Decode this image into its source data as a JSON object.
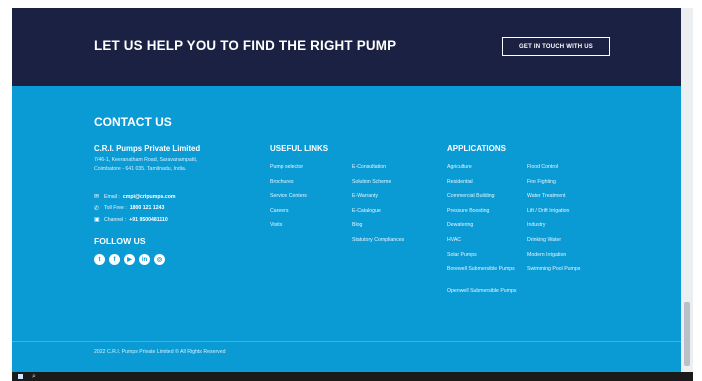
{
  "banner": {
    "title": "LET US HELP YOU TO FIND THE RIGHT PUMP",
    "cta_label": "GET IN TOUCH WITH US"
  },
  "contact": {
    "section_title": "CONTACT US",
    "company": "C.R.I. Pumps Private Limited",
    "address_line1": "7/46-1, Keeranatham Road, Saravanampatti,",
    "address_line2": "Coimbatore - 641 035. Tamilnadu, India.",
    "email_label": "Email :",
    "email_value": "cmpi@cripumps.com",
    "tollfree_label": "Toll Free :",
    "tollfree_value": "1800 121 1243",
    "channel_label": "Channel :",
    "channel_value": "+91 9500481110",
    "follow_title": "FOLLOW US",
    "social_icons": [
      "twitter-icon",
      "facebook-icon",
      "youtube-icon",
      "linkedin-icon",
      "instagram-icon"
    ]
  },
  "useful_links": {
    "title": "USEFUL LINKS",
    "col1": [
      "Pump selector",
      "Brochures",
      "Service Centers",
      "Careers",
      "Visits"
    ],
    "col2": [
      "E-Consultation",
      "Solution Scheme",
      "E-Warranty",
      "E-Catalogue",
      "Blog",
      "Statutory Compliances"
    ]
  },
  "applications": {
    "title": "APPLICATIONS",
    "col1": [
      "Agriculture",
      "Residential",
      "Commercial Building",
      "Pressure Boosting",
      "Dewatering",
      "HVAC",
      "Solar Pumps",
      "Borewell Submersible Pumps",
      "Openwell Submersible Pumps"
    ],
    "col2": [
      "Flood Control",
      "Fire Fighting",
      "Water Treatment",
      "Lift / Drift Irrigation",
      "Industry",
      "Drinking Water",
      "Modern Irrigation",
      "Swimming Pool Pumps"
    ]
  },
  "footer": {
    "copyright": "2022 C.R.I. Pumps Private Limited © All Rights Reserved"
  },
  "taskbar": {
    "search_glyph": "⌕"
  },
  "colors": {
    "banner_bg": "#1b2142",
    "footer_bg": "#0a9bd5",
    "text": "#ffffff"
  }
}
